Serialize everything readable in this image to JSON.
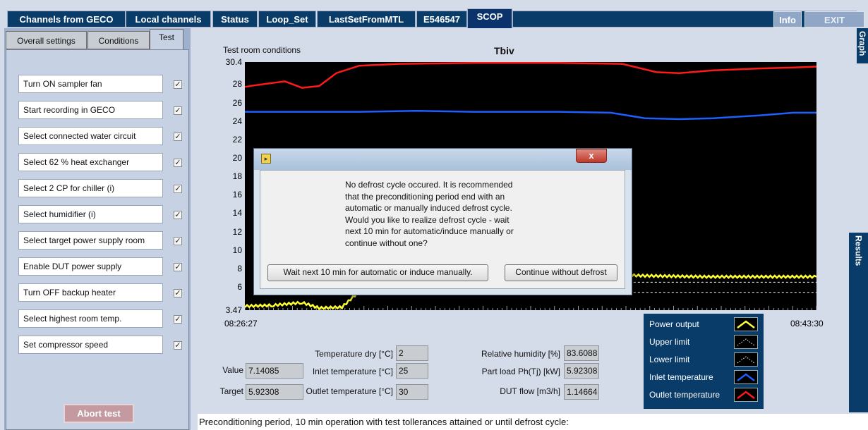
{
  "top_tabs": [
    {
      "label": "Channels from GECO"
    },
    {
      "label": "Local channels"
    },
    {
      "label": "Status"
    },
    {
      "label": "Loop_Set"
    },
    {
      "label": "LastSetFromMTL"
    },
    {
      "label": "E546547"
    },
    {
      "label": "SCOP",
      "active": true
    }
  ],
  "top_buttons": {
    "info": "Info",
    "exit": "EXIT"
  },
  "sub_tabs": [
    {
      "label": "Overall settings"
    },
    {
      "label": "Conditions"
    },
    {
      "label": "Test",
      "active": true
    }
  ],
  "checklist": [
    {
      "label": "Turn ON sampler fan",
      "checked": true
    },
    {
      "label": "Start recording in GECO",
      "checked": true
    },
    {
      "label": "Select connected water circuit",
      "checked": true
    },
    {
      "label": "Select 62 % heat exchanger",
      "checked": true
    },
    {
      "label": "Select 2 CP for chiller (i)",
      "checked": true
    },
    {
      "label": "Select humidifier (i)",
      "checked": true
    },
    {
      "label": "Select target power supply room",
      "checked": true
    },
    {
      "label": "Enable DUT power supply",
      "checked": true
    },
    {
      "label": "Turn OFF backup heater",
      "checked": true
    },
    {
      "label": "Select highest room temp.",
      "checked": true
    },
    {
      "label": "Set compressor speed",
      "checked": true
    }
  ],
  "check_glyph": "✓",
  "abort_button": "Abort test",
  "side_tabs": {
    "graph": "Graph",
    "results": "Results"
  },
  "chart_data": {
    "type": "line",
    "title": "Tbiv",
    "subtitle": "Test room conditions",
    "x_start_label": "08:26:27",
    "x_end_label": "08:43:30",
    "ylim": [
      3.47,
      30.4
    ],
    "y_ticks": [
      "30.4",
      "28",
      "26",
      "24",
      "22",
      "20",
      "18",
      "16",
      "14",
      "12",
      "10",
      "8",
      "6",
      "3.47"
    ],
    "background": "#000000",
    "series": [
      {
        "name": "Outlet temperature",
        "color": "#ff1a1a",
        "x": [
          0,
          0.02,
          0.07,
          0.1,
          0.13,
          0.16,
          0.2,
          0.27,
          0.4,
          0.55,
          0.66,
          0.72,
          0.76,
          0.82,
          0.9,
          0.96,
          1.0
        ],
        "values": [
          27.7,
          27.9,
          28.3,
          27.6,
          27.8,
          29.2,
          30.0,
          30.2,
          30.3,
          30.3,
          30.2,
          29.3,
          29.2,
          29.5,
          29.7,
          29.8,
          29.9
        ]
      },
      {
        "name": "Inlet temperature",
        "color": "#1f5fff",
        "x": [
          0,
          0.2,
          0.3,
          0.4,
          0.55,
          0.64,
          0.7,
          0.76,
          0.82,
          0.9,
          0.96,
          1.0
        ],
        "values": [
          25.0,
          25.0,
          25.1,
          25.0,
          25.0,
          24.9,
          24.3,
          24.2,
          24.3,
          24.6,
          24.9,
          24.9
        ]
      },
      {
        "name": "Power output",
        "color": "#ffff33",
        "x": [
          0,
          0.05,
          0.1,
          0.13,
          0.17,
          0.2,
          0.22,
          0.25,
          0.28,
          0.55,
          0.6,
          0.7,
          0.8,
          0.9,
          1.0
        ],
        "values": [
          3.9,
          4.0,
          4.3,
          3.7,
          3.8,
          5.5,
          6.8,
          7.2,
          7.2,
          7.3,
          7.4,
          7.2,
          7.1,
          7.1,
          7.1
        ]
      },
      {
        "name": "Upper limit",
        "color": "#ffffff",
        "x": [
          0.28,
          1.0
        ],
        "values": [
          6.5,
          6.5
        ]
      },
      {
        "name": "Lower limit",
        "color": "#ffffff",
        "x": [
          0.28,
          1.0
        ],
        "values": [
          5.4,
          5.4
        ]
      }
    ]
  },
  "legend": [
    {
      "label": "Power output",
      "color": "#ffff33",
      "icon": "yellow-line-icon"
    },
    {
      "label": "Upper limit",
      "color": "#ffffff",
      "icon": "white-dotted-line-icon"
    },
    {
      "label": "Lower limit",
      "color": "#ffffff",
      "icon": "white-dotted-line-icon"
    },
    {
      "label": "Inlet temperature",
      "color": "#1f5fff",
      "icon": "blue-line-icon"
    },
    {
      "label": "Outlet temperature",
      "color": "#ff1a1a",
      "icon": "red-line-icon"
    }
  ],
  "indicators": {
    "value": {
      "label": "Value",
      "val": "7.14085"
    },
    "target": {
      "label": "Target",
      "val": "5.92308"
    },
    "temp_dry": {
      "label": "Temperature dry [°C]",
      "val": "2"
    },
    "inlet_temp": {
      "label": "Inlet temperature [°C]",
      "val": "25"
    },
    "outlet_temp": {
      "label": "Outlet temperature [°C]",
      "val": "30"
    },
    "rel_humidity": {
      "label": "Relative humidity [%]",
      "val": "83.6088"
    },
    "part_load": {
      "label": "Part load Ph(Tj) [kW]",
      "val": "5.92308"
    },
    "dut_flow": {
      "label": "DUT flow [m3/h]",
      "val": "1.14664"
    }
  },
  "status_text": "Preconditioning period, 10 min operation with test tollerances attained or until defrost cycle:",
  "dialog": {
    "close_glyph": "x",
    "message": "No defrost cycle occured. It is recommended\nthat the preconditioning period end with an\nautomatic or manually induced defrost cycle.\nWould you like to realize defrost cycle - wait\nnext 10 min for automatic/induce manually or\ncontinue without one?",
    "button_wait": "Wait next 10 min for automatic or induce manually.",
    "button_continue": "Continue without defrost"
  }
}
